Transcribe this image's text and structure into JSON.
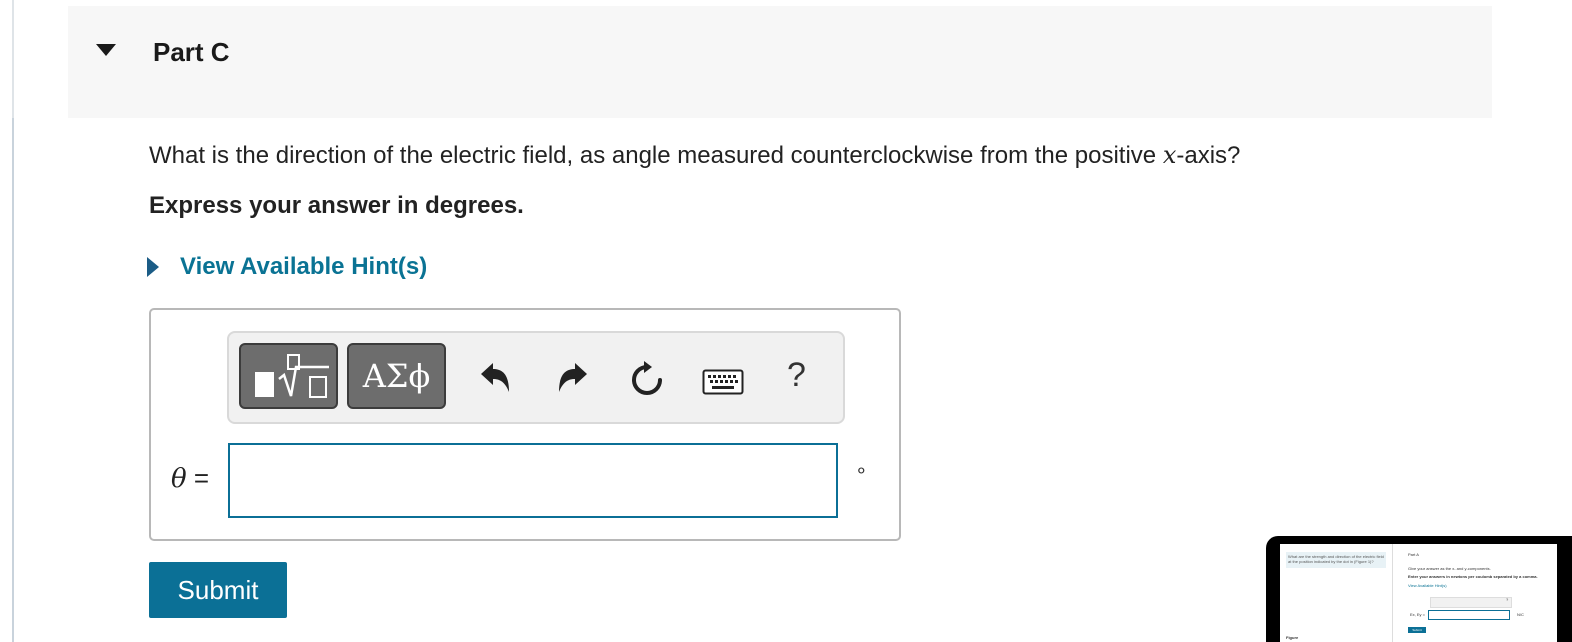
{
  "part": {
    "title": "Part C",
    "toggle_icon": "caret-down-icon"
  },
  "question": {
    "text_before": "What is the direction of the electric field, as angle measured counterclockwise from the positive ",
    "variable": "x",
    "text_after": "-axis?",
    "instruction": "Express your answer in degrees."
  },
  "hint": {
    "label": "View Available Hint(s)",
    "icon": "caret-right-icon"
  },
  "toolbar": {
    "templates_icon": "templates-icon",
    "symbols_label": "ΑΣϕ",
    "undo_icon": "undo-icon",
    "redo_icon": "redo-icon",
    "reset_icon": "reset-icon",
    "keyboard_icon": "keyboard-icon",
    "help_label": "?"
  },
  "answer": {
    "variable": "θ",
    "equals": "=",
    "value": "",
    "unit": "∘"
  },
  "submit": {
    "label": "Submit"
  },
  "thumbnail": {
    "prompt_text": "What are the strength and direction of the electric field at the position indicated by the dot in (Figure 1)?",
    "part_label": "Part A",
    "give_text": "Give your answer as the x- and y-components.",
    "enter_text": "Enter your answers in newtons per coulomb separated by a comma.",
    "hint_text": "View Available Hint(s)",
    "input_label": "Ex, Ey =",
    "unit_text": "N/C",
    "submit_label": "Submit",
    "figure_label": "Figure",
    "help_label": "?"
  },
  "colors": {
    "accent": "#0b7096",
    "link": "#0a7394",
    "header_bg": "#f7f7f7",
    "toolbar_button": "#6d6d6d"
  }
}
